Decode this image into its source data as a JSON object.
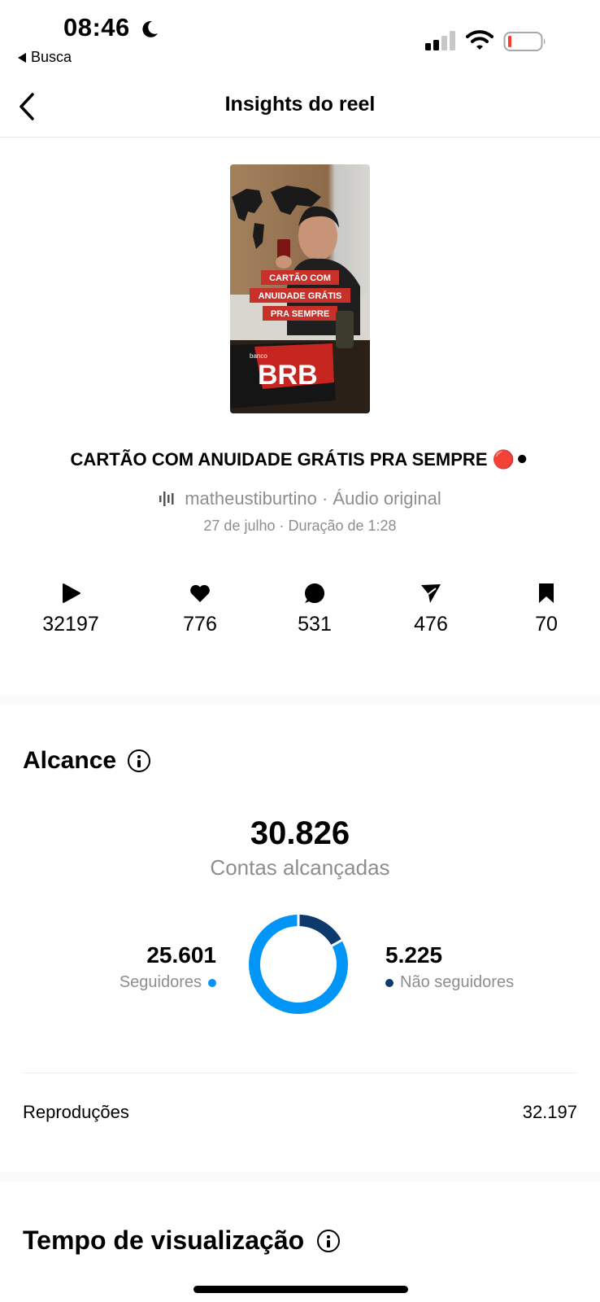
{
  "status_bar": {
    "time": "08:46",
    "back_app": "Busca"
  },
  "header": {
    "title": "Insights do reel"
  },
  "thumbnail": {
    "overlay_lines": [
      "CARTÃO COM",
      "ANUIDADE GRÁTIS",
      "PRA SEMPRE"
    ],
    "banner_text": "BRB",
    "banner_small": "banco"
  },
  "reel": {
    "title": "CARTÃO COM ANUIDADE GRÁTIS PRA SEMPRE 🔴⚫",
    "audio": "matheustiburtino · Áudio original",
    "meta": "27 de julho · Duração de 1:28"
  },
  "stats": {
    "plays": "32197",
    "likes": "776",
    "comments": "531",
    "shares": "476",
    "saves": "70"
  },
  "reach": {
    "title": "Alcance",
    "total": "30.826",
    "caption": "Contas alcançadas",
    "followers_value": "25.601",
    "followers_label": "Seguidores",
    "nonfollowers_value": "5.225",
    "nonfollowers_label": "Não seguidores",
    "followers_color": "#0095f6",
    "nonfollowers_color": "#0e3a6b",
    "followers_share": 0.8305
  },
  "plays_row": {
    "label": "Reproduções",
    "value": "32.197"
  },
  "watch_time": {
    "title": "Tempo de visualização"
  }
}
